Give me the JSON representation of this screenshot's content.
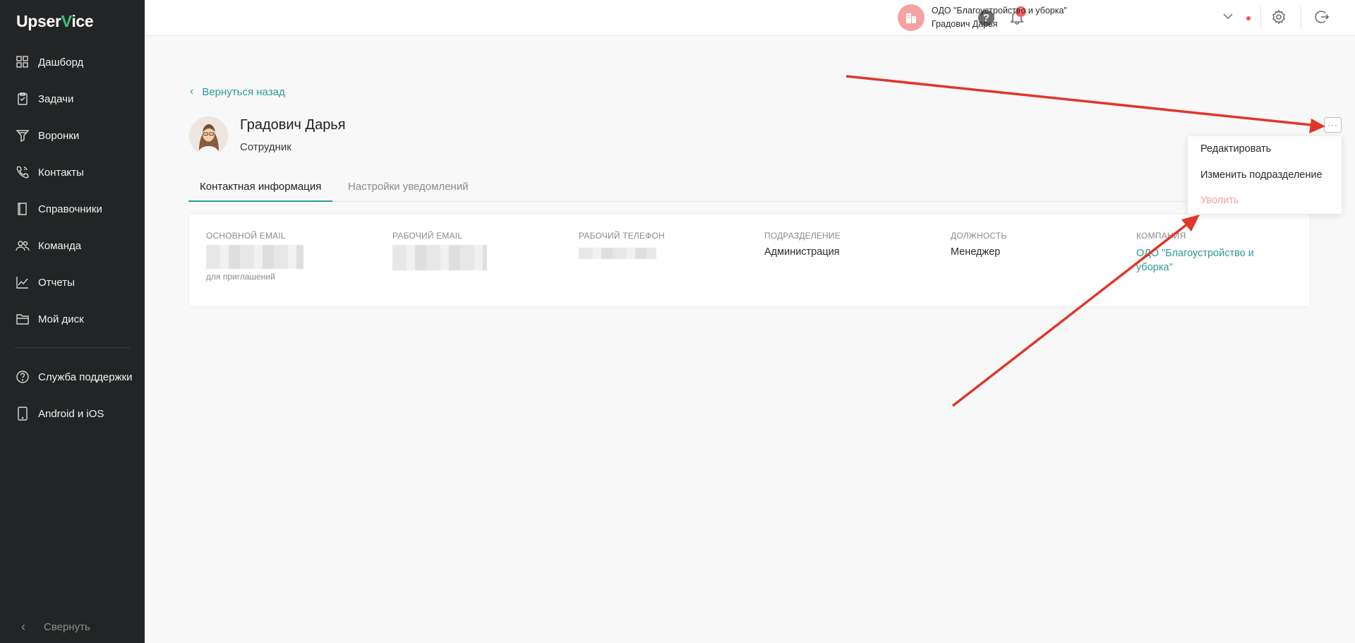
{
  "sidebar": {
    "logo_prefix": "Upser",
    "logo_v": "V",
    "logo_suffix": "ice",
    "items": [
      {
        "label": "Дашборд",
        "icon": "dashboard-icon"
      },
      {
        "label": "Задачи",
        "icon": "tasks-icon"
      },
      {
        "label": "Воронки",
        "icon": "funnel-icon"
      },
      {
        "label": "Контакты",
        "icon": "contacts-icon"
      },
      {
        "label": "Справочники",
        "icon": "book-icon"
      },
      {
        "label": "Команда",
        "icon": "team-icon"
      },
      {
        "label": "Отчеты",
        "icon": "reports-icon"
      },
      {
        "label": "Мой диск",
        "icon": "folder-icon"
      }
    ],
    "secondary": [
      {
        "label": "Служба поддержки",
        "icon": "help-circle-icon"
      },
      {
        "label": "Android и iOS",
        "icon": "mobile-icon"
      }
    ],
    "collapse_label": "Свернуть"
  },
  "header": {
    "help_symbol": "?",
    "notification_count": "7",
    "org_name": "ОДО \"Благоустройство и уборка\"",
    "user_name": "Градович Дарья"
  },
  "main": {
    "back_label": "Вернуться назад",
    "profile": {
      "name": "Градович Дарья",
      "role": "Сотрудник"
    },
    "tabs": [
      {
        "label": "Контактная информация",
        "active": true
      },
      {
        "label": "Настройки уведомлений",
        "active": false
      }
    ],
    "fields": [
      {
        "label": "Основной email",
        "value": "",
        "note": "для приглашений"
      },
      {
        "label": "Рабочий email",
        "value": ""
      },
      {
        "label": "Рабочий телефон",
        "value": ""
      },
      {
        "label": "Подразделение",
        "value": "Администрация"
      },
      {
        "label": "Должность",
        "value": "Менеджер"
      },
      {
        "label": "Компания",
        "value": "ОДО \"Благоустройство и уборка\""
      }
    ],
    "more_symbol": "···",
    "menu": [
      {
        "label": "Редактировать"
      },
      {
        "label": "Изменить подразделение"
      },
      {
        "label": "Уволить"
      }
    ]
  },
  "colors": {
    "sidebar_bg": "#232425",
    "accent": "#2c9a96",
    "danger_text": "#f3a0a0",
    "annotation_arrow": "#e2352b"
  }
}
